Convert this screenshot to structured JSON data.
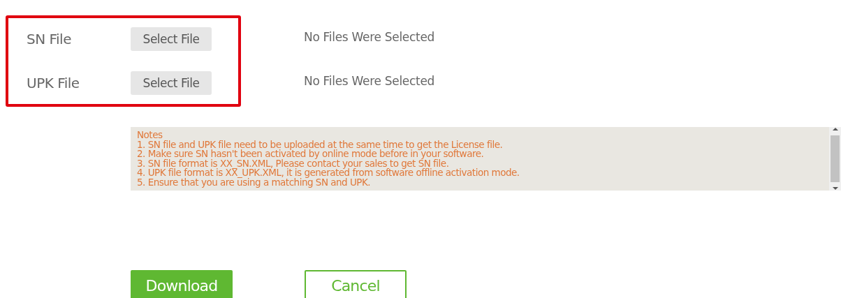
{
  "file_fields": {
    "highlighted": true,
    "rows": [
      {
        "label": "SN File",
        "button": "Select File",
        "status": "No Files Were Selected"
      },
      {
        "label": "UPK File",
        "button": "Select File",
        "status": "No Files Were Selected"
      }
    ]
  },
  "notes": {
    "title": "Notes",
    "lines": [
      "1. SN file and UPK file need to be uploaded at the same time to get the License file.",
      "2. Make sure SN hasn't been activated by online mode before in your software.",
      "3. SN file format is XX_SN.XML, Please contact your sales to get SN file.",
      "4. UPK file format is XX_UPK.XML, it is generated from software offline activation mode.",
      "5. Ensure that you are using a matching SN and UPK."
    ]
  },
  "buttons": [
    {
      "label": "Download",
      "kind": "primary"
    },
    {
      "label": "Cancel",
      "kind": "secondary"
    }
  ]
}
